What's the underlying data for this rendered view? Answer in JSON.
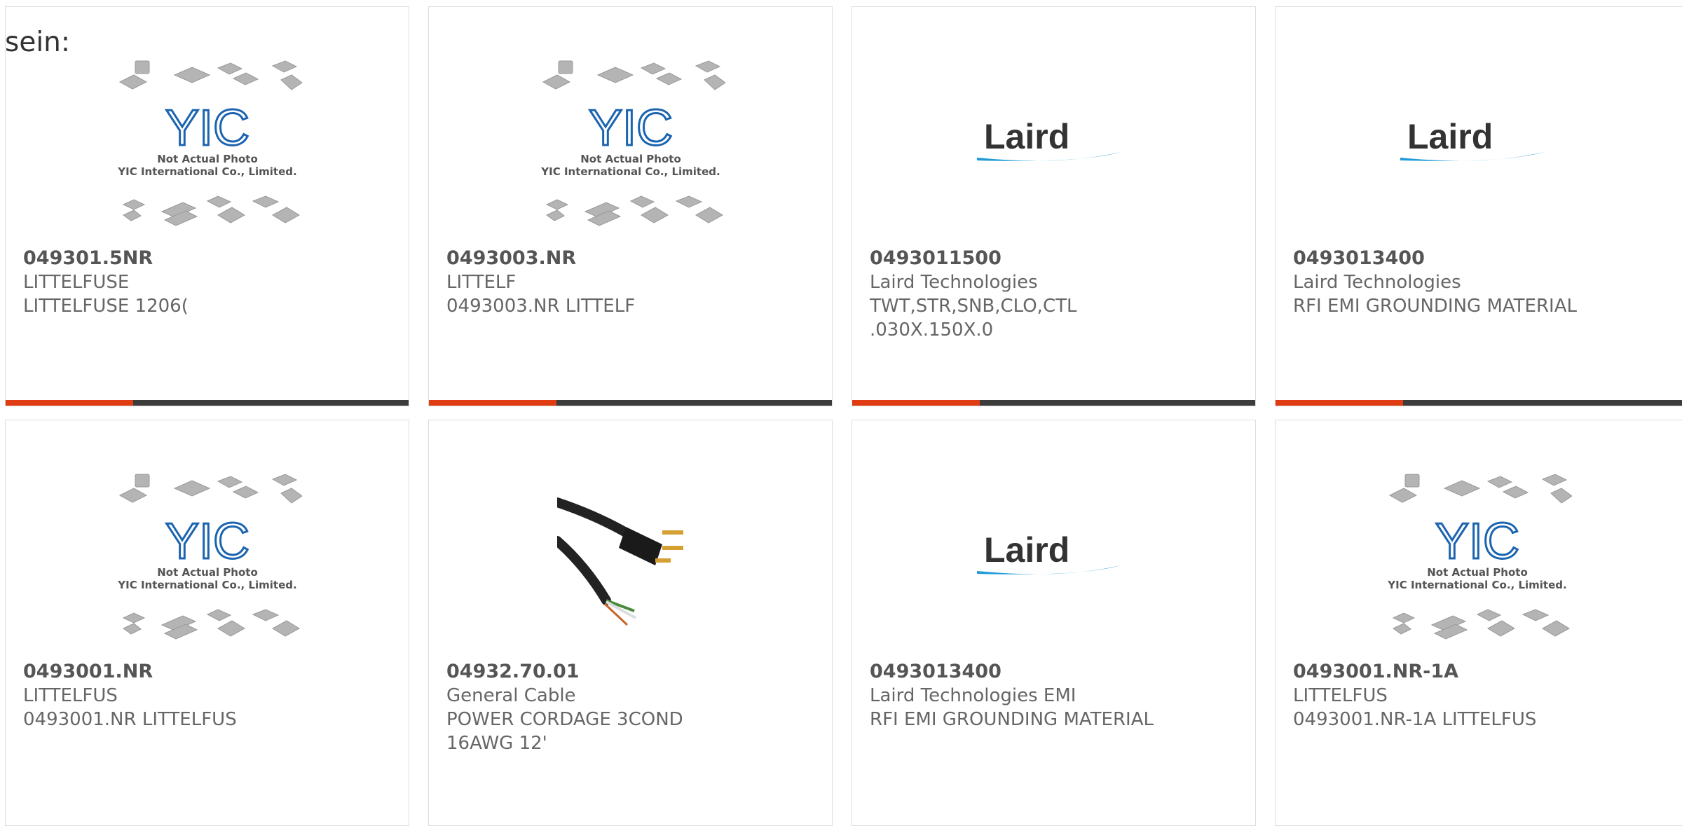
{
  "intro": "sein:",
  "colors": {
    "accent": "#e03c14",
    "bar": "#3c3c3c",
    "laird_blue": "#1f9ad6",
    "yic_blue": "#1b64b0"
  },
  "placeholder": {
    "line1": "Not Actual Photo",
    "line2": "YIC International Co., Limited.",
    "logo": "YIC"
  },
  "laird_logo": "Laird",
  "products": [
    {
      "part": "049301.5NR",
      "maker": "LITTELFUSE",
      "desc1": "LITTELFUSE 1206(",
      "desc2": "",
      "image": "yic-placeholder"
    },
    {
      "part": "0493003.NR",
      "maker": "LITTELF",
      "desc1": "0493003.NR LITTELF",
      "desc2": "",
      "image": "yic-placeholder"
    },
    {
      "part": "0493011500",
      "maker": "Laird Technologies",
      "desc1": "TWT,STR,SNB,CLO,CTL",
      "desc2": ".030X.150X.0",
      "image": "laird-logo"
    },
    {
      "part": "0493013400",
      "maker": "Laird Technologies",
      "desc1": "RFI EMI GROUNDING MATERIAL",
      "desc2": "",
      "image": "laird-logo"
    },
    {
      "part": "0493001.NR",
      "maker": "LITTELFUS",
      "desc1": "0493001.NR LITTELFUS",
      "desc2": "",
      "image": "yic-placeholder"
    },
    {
      "part": "04932.70.01",
      "maker": "General Cable",
      "desc1": "POWER CORDAGE 3COND",
      "desc2": "16AWG 12'",
      "image": "power-cord-photo"
    },
    {
      "part": "0493013400",
      "maker": "Laird Technologies EMI",
      "desc1": "RFI EMI GROUNDING MATERIAL",
      "desc2": "",
      "image": "laird-logo"
    },
    {
      "part": "0493001.NR-1A",
      "maker": "LITTELFUS",
      "desc1": "0493001.NR-1A LITTELFUS",
      "desc2": "",
      "image": "yic-placeholder"
    }
  ]
}
